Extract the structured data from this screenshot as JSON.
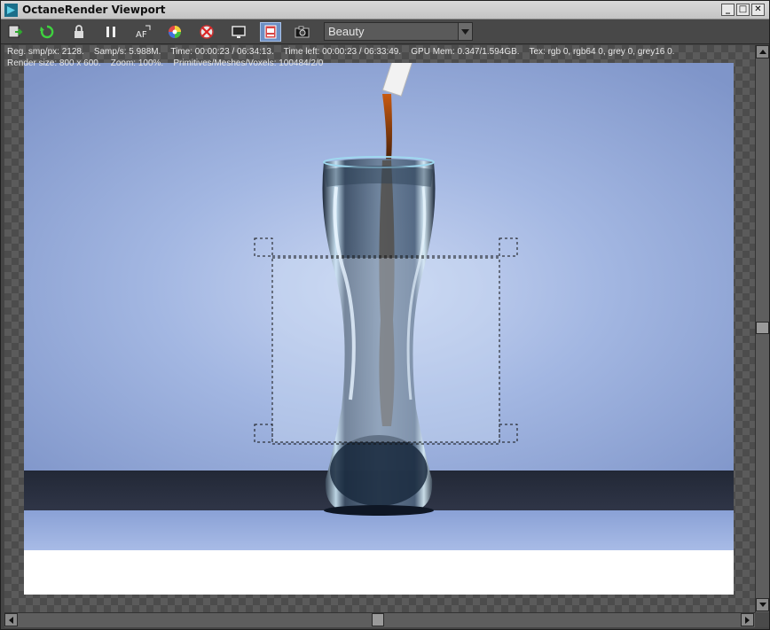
{
  "window": {
    "title": "OctaneRender Viewport",
    "min_label": "_",
    "max_label": "□",
    "close_label": "✕"
  },
  "toolbar": {
    "buttons": [
      {
        "name": "send-scene-icon"
      },
      {
        "name": "restart-render-icon"
      },
      {
        "name": "lock-icon"
      },
      {
        "name": "pause-icon"
      },
      {
        "name": "autofocus-picker-icon"
      },
      {
        "name": "color-picker-icon"
      },
      {
        "name": "region-render-icon"
      },
      {
        "name": "display-settings-icon"
      },
      {
        "name": "render-region-icon",
        "active": true
      },
      {
        "name": "camera-icon"
      }
    ],
    "afp_label": "AF",
    "render_pass": "Beauty"
  },
  "stats": {
    "line1": "Reg. smp/px: 2128.    Samp/s: 5.988M.    Time: 00:00:23 / 06:34:13.    Time left: 00:00:23 / 06:33:49.    GPU Mem: 0.347/1.594GB.    Tex: rgb 0, rgb64 0, grey 0, grey16 0.",
    "line2": "Render size: 800 x 600.    Zoom: 100%.    Primitives/Meshes/Voxels: 100484/2/0"
  },
  "colors": {
    "accent": "#6c8fc4",
    "background_blue": "#8aa3d4",
    "floor_dark": "#2d3447"
  }
}
